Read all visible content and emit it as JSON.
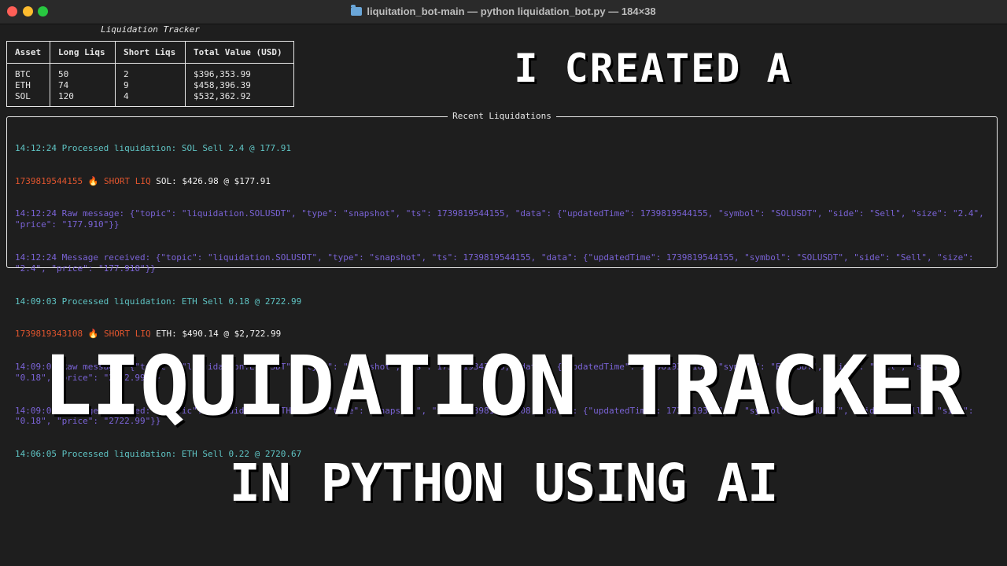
{
  "window": {
    "title": "liquitation_bot-main — python liquidation_bot.py — 184×38"
  },
  "stats_table": {
    "caption": "Liquidation Tracker",
    "headers": [
      "Asset",
      "Long Liqs",
      "Short Liqs",
      "Total Value (USD)"
    ],
    "rows": [
      [
        "BTC",
        "50",
        "2",
        "$396,353.99"
      ],
      [
        "ETH",
        "74",
        "9",
        "$458,396.39"
      ],
      [
        "SOL",
        "120",
        "4",
        "$532,362.92"
      ]
    ]
  },
  "recent": {
    "title": "Recent Liquidations",
    "lines": [
      {
        "color": "#5fc4c4",
        "text": "14:12:24 Processed liquidation: SOL Sell 2.4 @ 177.91"
      },
      {
        "ts": "1739819544155",
        "emoji": "🔥",
        "tag": "SHORT LIQ",
        "text": "SOL: $426.98 @ $177.91"
      },
      {
        "color": "#7a63d6",
        "text": "14:12:24 Raw message: {\"topic\": \"liquidation.SOLUSDT\", \"type\": \"snapshot\", \"ts\": 1739819544155, \"data\": {\"updatedTime\": 1739819544155, \"symbol\": \"SOLUSDT\", \"side\": \"Sell\", \"size\": \"2.4\", \"price\": \"177.910\"}}"
      },
      {
        "color": "#7a63d6",
        "text": "14:12:24 Message received: {\"topic\": \"liquidation.SOLUSDT\", \"type\": \"snapshot\", \"ts\": 1739819544155, \"data\": {\"updatedTime\": 1739819544155, \"symbol\": \"SOLUSDT\", \"side\": \"Sell\", \"size\": \"2.4\", \"price\": \"177.910\"}}"
      },
      {
        "color": "#5fc4c4",
        "text": "14:09:03 Processed liquidation: ETH Sell 0.18 @ 2722.99"
      },
      {
        "ts": "1739819343108",
        "emoji": "🔥",
        "tag": "SHORT LIQ",
        "text": "ETH: $490.14 @ $2,722.99"
      },
      {
        "color": "#7a63d6",
        "text": "14:09:03 Raw message: {\"topic\": \"liquidation.ETHUSDT\", \"type\": \"snapshot\", \"ts\": 1739819343108, \"data\": {\"updatedTime\": 1739819343108, \"symbol\": \"ETHUSDT\", \"side\": \"Sell\", \"size\": \"0.18\", \"price\": \"2722.99\"}}"
      },
      {
        "color": "#7a63d6",
        "text": "14:09:03 Message received: {\"topic\": \"liquidation.ETHUSDT\", \"type\": \"snapshot\", \"ts\": 1739819343108, \"data\": {\"updatedTime\": 1739819343108, \"symbol\": \"ETHUSDT\", \"side\": \"Sell\", \"size\": \"0.18\", \"price\": \"2722.99\"}}"
      },
      {
        "color": "#5fc4c4",
        "text": "14:06:05 Processed liquidation: ETH Sell 0.22 @ 2720.67"
      }
    ]
  },
  "overlay": {
    "line1": "I CREATED A",
    "line2": "LIQUIDATION TRACKER",
    "line3": "IN PYTHON USING AI"
  }
}
